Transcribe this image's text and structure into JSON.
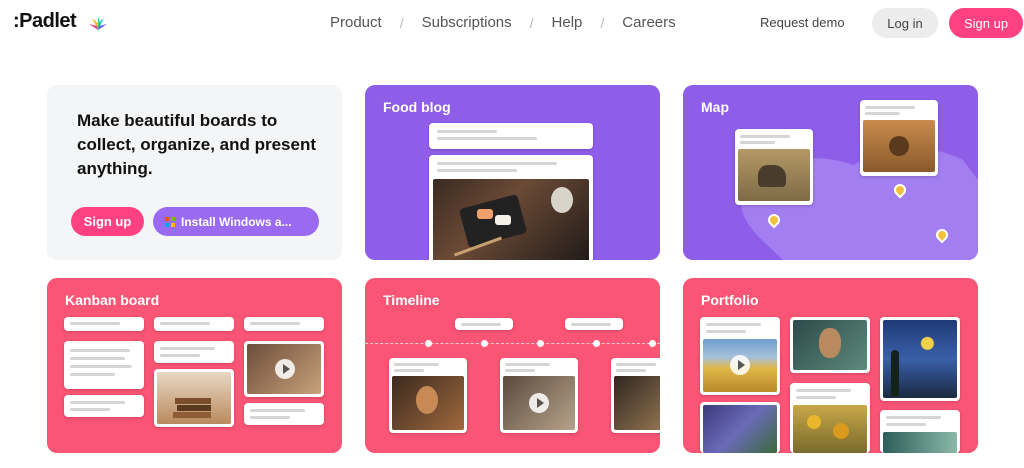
{
  "header": {
    "logo_text": ":Padlet",
    "nav": [
      "Product",
      "Subscriptions",
      "Help",
      "Careers"
    ],
    "request_demo": "Request demo",
    "login": "Log in",
    "signup": "Sign up"
  },
  "hero": {
    "headline": "Make beautiful boards to collect, organize, and present anything.",
    "signup": "Sign up",
    "install": "Install Windows a..."
  },
  "cards": {
    "food": "Food blog",
    "map": "Map",
    "kanban": "Kanban board",
    "timeline": "Timeline",
    "portfolio": "Portfolio"
  },
  "colors": {
    "brand_pink": "#ff4081",
    "purple": "#8f5ee8",
    "pink_card": "#fa5575"
  }
}
